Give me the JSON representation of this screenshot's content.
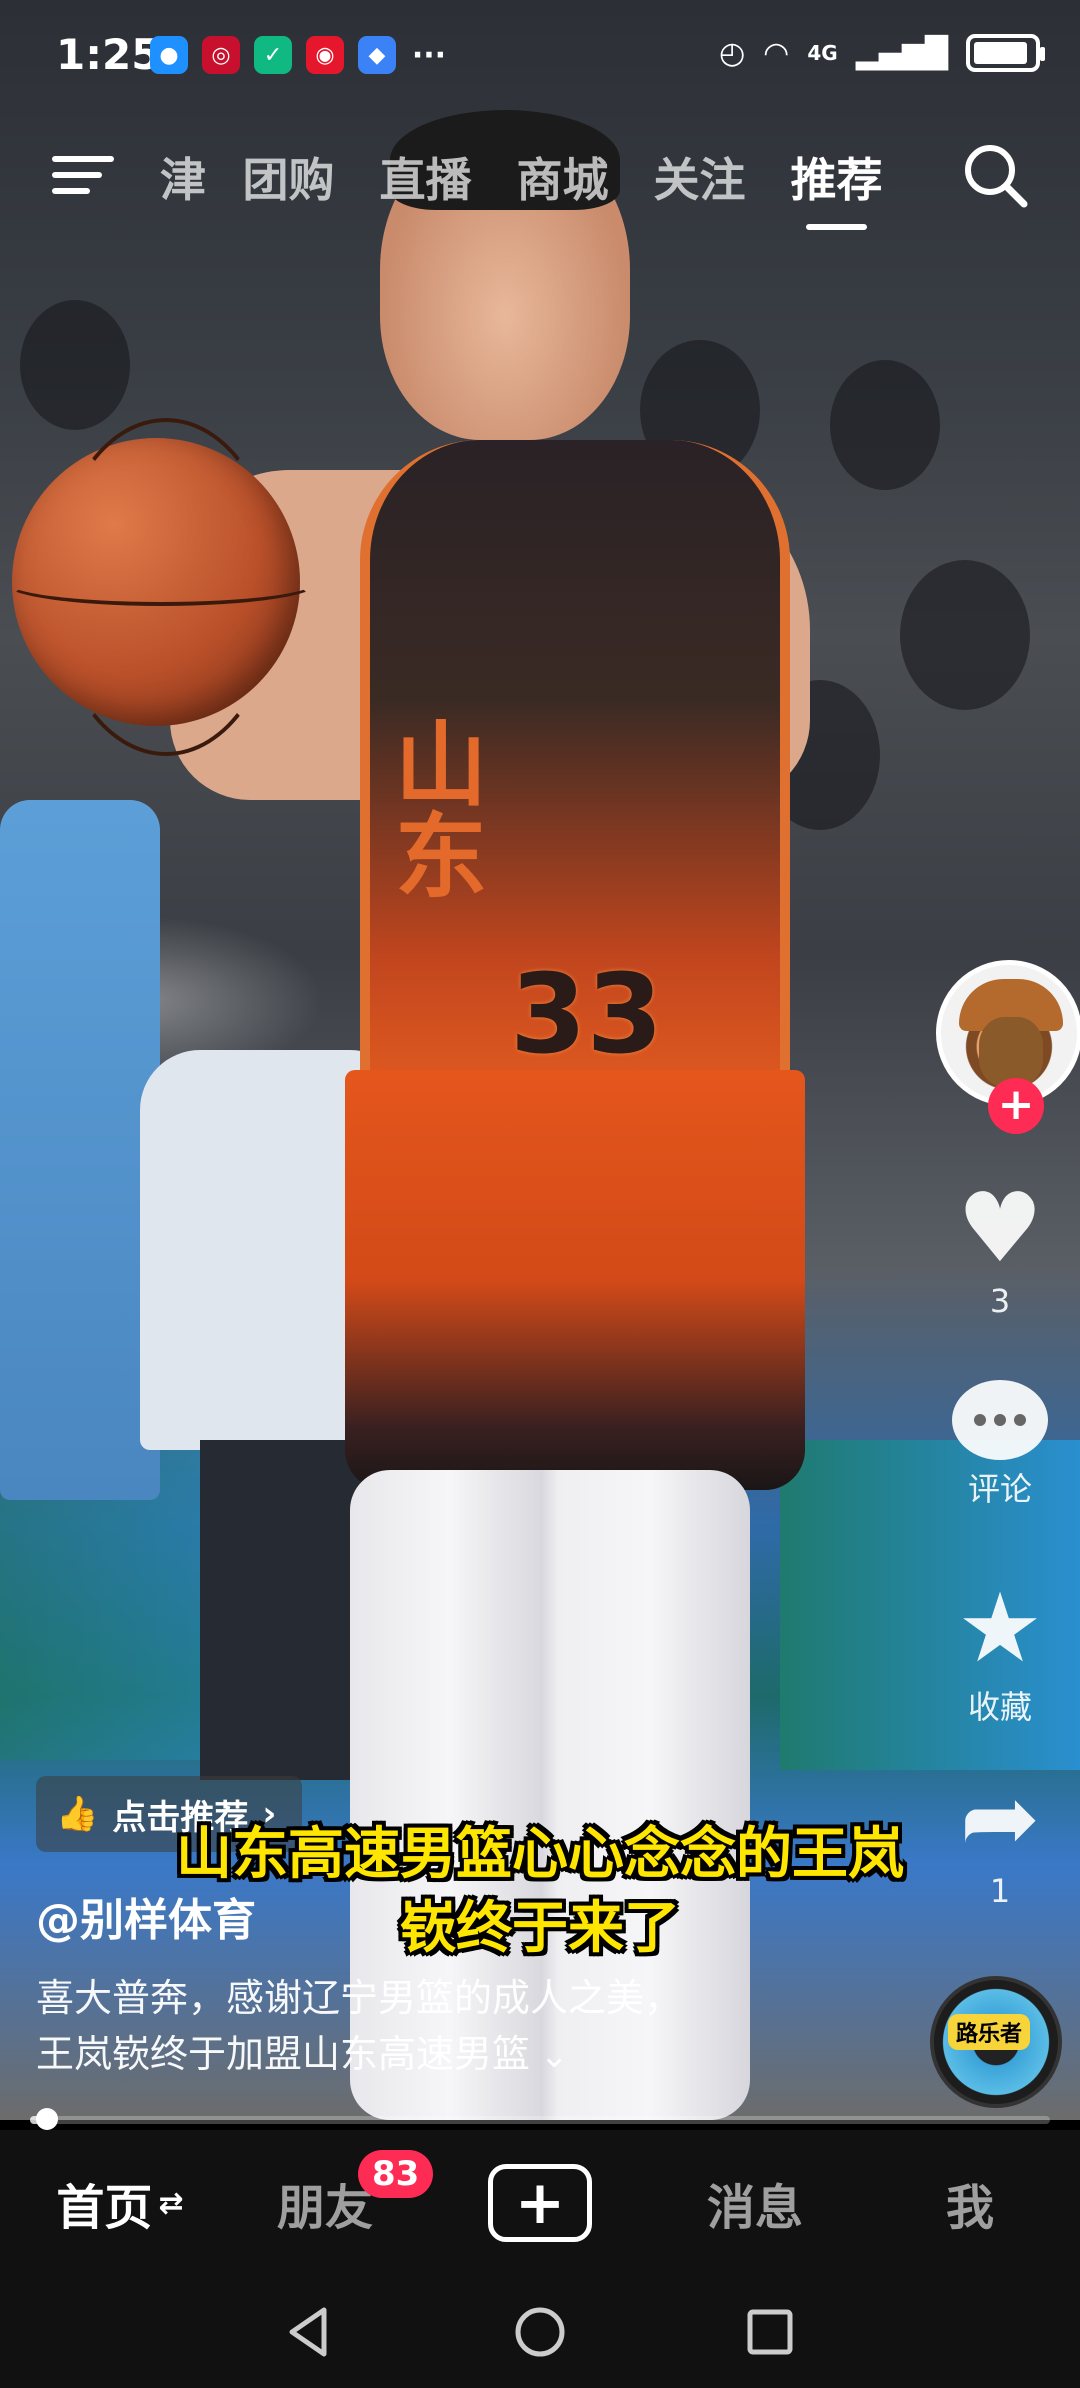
{
  "status_bar": {
    "time": "1:25",
    "notification_icons": [
      "message-icon",
      "bank-icon",
      "shield-icon",
      "weibo-icon",
      "app-icon",
      "more-icon"
    ],
    "network": "4G",
    "battery_level": 0.92
  },
  "top_nav": {
    "tabs": [
      {
        "label": "津",
        "active": false
      },
      {
        "label": "团购",
        "active": false
      },
      {
        "label": "直播",
        "active": false
      },
      {
        "label": "商城",
        "active": false
      },
      {
        "label": "关注",
        "active": false
      },
      {
        "label": "推荐",
        "active": true
      }
    ]
  },
  "rail": {
    "like_count": "3",
    "comment_label": "评论",
    "favorite_label": "收藏",
    "share_count": "1",
    "music_tag": "路乐者"
  },
  "caption": {
    "recommend_label": "点击推荐",
    "overlay_title_line1": "山东高速男篮心心念念的王岚",
    "overlay_title_line2": "嵚终于来了",
    "author": "@别样体育",
    "desc_line1": "喜大普奔，感谢辽宁男篮的成人之美，",
    "desc_line2": "王岚嵚终于加盟山东高速男篮"
  },
  "progress": 0.01,
  "bottom_nav": {
    "home": "首页",
    "friends": "朋友",
    "friends_badge": "83",
    "create": "+",
    "messages": "消息",
    "me": "我"
  },
  "colors": {
    "accent": "#fe2c55",
    "title_yellow": "#ffe600",
    "nav_bg": "#111111"
  }
}
